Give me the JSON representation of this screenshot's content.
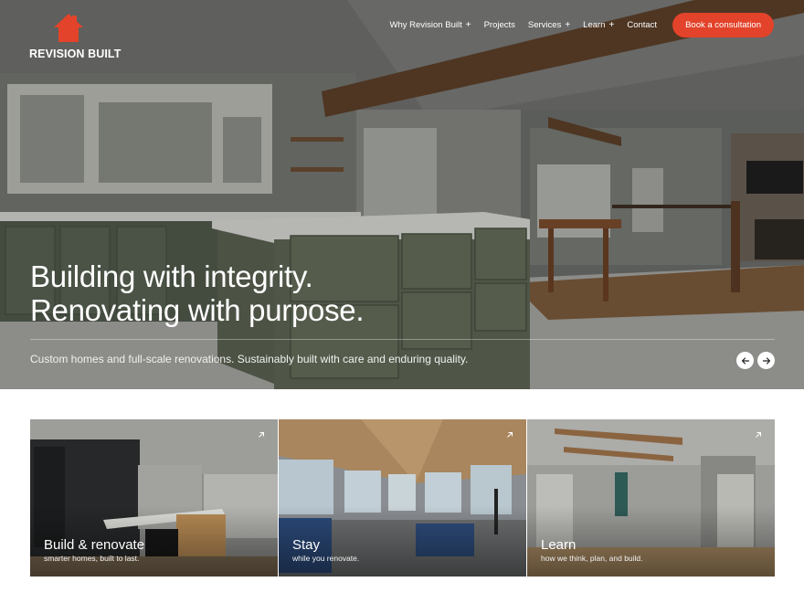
{
  "brand": {
    "name": "REVISION BUILT",
    "accent": "#e2432a"
  },
  "nav": {
    "items": [
      {
        "label": "Why Revision Built",
        "has_submenu": true
      },
      {
        "label": "Projects",
        "has_submenu": false
      },
      {
        "label": "Services",
        "has_submenu": true
      },
      {
        "label": "Learn",
        "has_submenu": true
      },
      {
        "label": "Contact",
        "has_submenu": false
      }
    ],
    "plus": "+",
    "cta_label": "Book a consultation"
  },
  "hero": {
    "headline_line1": "Building with integrity.",
    "headline_line2": "Renovating with purpose.",
    "subtext": "Custom homes and full-scale renovations. Sustainably built with care and enduring quality.",
    "prev_icon": "arrow-left-icon",
    "next_icon": "arrow-right-icon"
  },
  "cards": [
    {
      "title": "Build & renovate",
      "description": "smarter homes, built to last.",
      "icon": "arrow-up-right-icon"
    },
    {
      "title": "Stay",
      "description": "while you renovate.",
      "icon": "arrow-up-right-icon"
    },
    {
      "title": "Learn",
      "description": "how we think, plan, and build.",
      "icon": "arrow-up-right-icon"
    }
  ]
}
